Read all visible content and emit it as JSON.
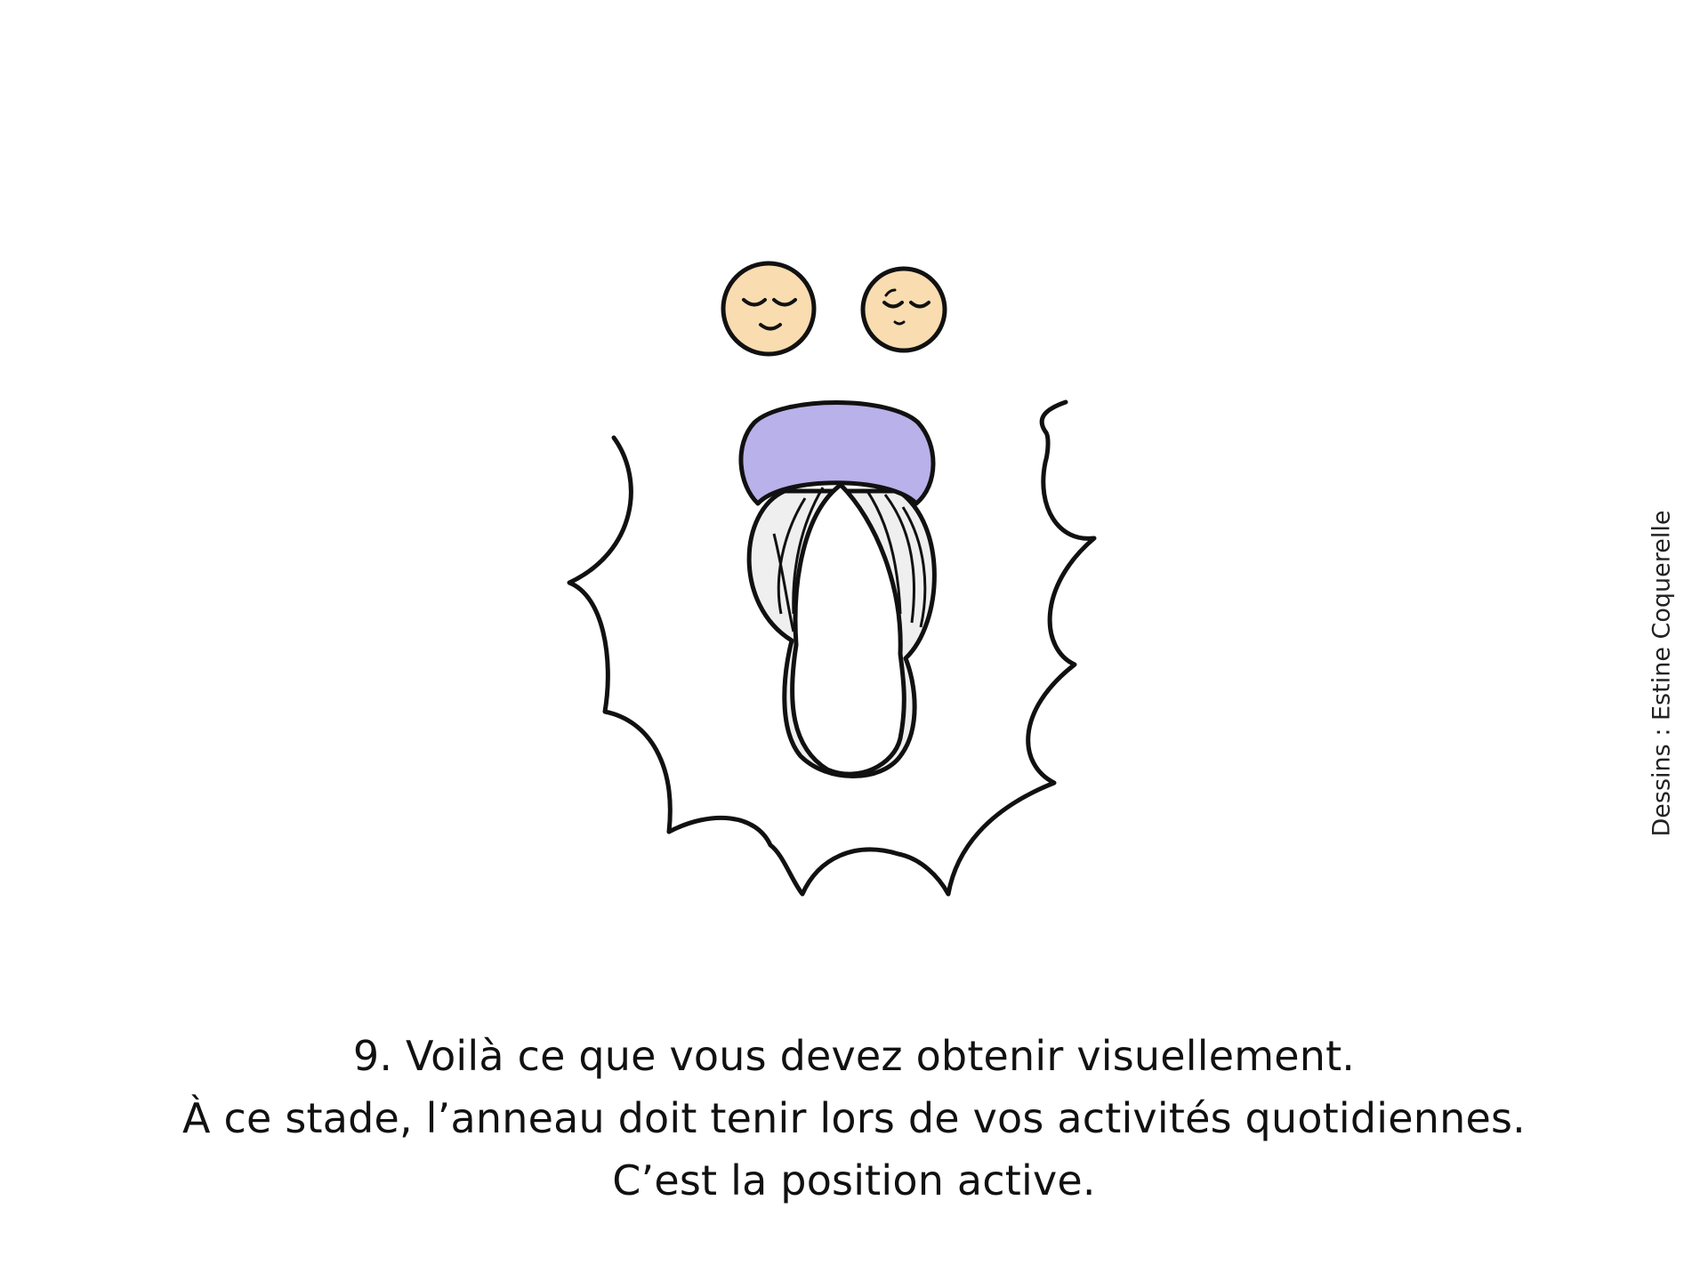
{
  "caption": {
    "line1": "9. Voilà ce que vous devez obtenir visuellement.",
    "line2": "À ce stade, l’anneau doit tenir lors de vos activités quotidiennes.",
    "line3": "C’est la position active."
  },
  "credit": "Dessins : Estine Coquerelle",
  "colors": {
    "ink": "#111111",
    "face_fill": "#f9dcb0",
    "ring_fill": "#b9b1ea",
    "tube_fill": "#efefef",
    "background": "#ffffff"
  },
  "icons": [
    "smiling-face-icon",
    "sleepy-face-icon",
    "cup-ring-icon",
    "burst-outline-icon"
  ]
}
